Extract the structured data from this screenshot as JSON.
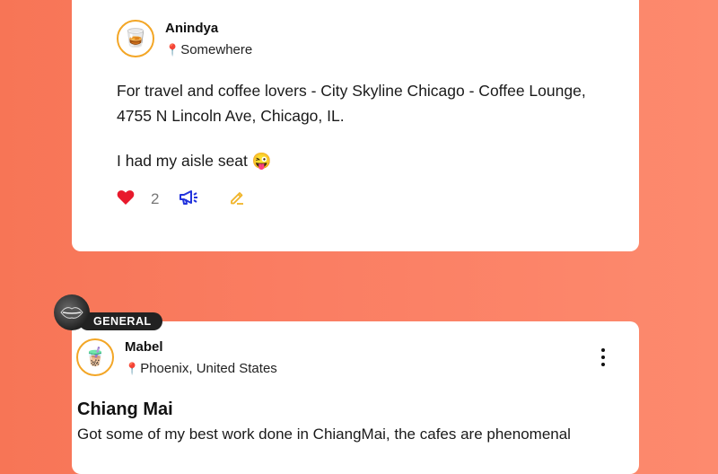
{
  "post1": {
    "avatar_icon": "iced-drink-icon",
    "username": "Anindya",
    "location": "Somewhere",
    "body_line1": "For travel and coffee lovers - City Skyline Chicago - Coffee Lounge,",
    "body_line2": "4755 N Lincoln Ave, Chicago, IL.",
    "body_line3": "I had my aisle seat 😜",
    "likes": "2",
    "icons": [
      "heart-icon",
      "megaphone-icon",
      "pencil-icon"
    ],
    "colors": {
      "heart": "#e8192c",
      "megaphone": "#2233dd",
      "pencil": "#f0b429"
    }
  },
  "post2": {
    "category": "GENERAL",
    "avatar_icon": "cold-brew-icon",
    "username": "Mabel",
    "location": "Phoenix, United States",
    "title": "Chiang Mai",
    "body": "Got some of my best work done in ChiangMai, the cafes are phenomenal"
  },
  "theme": {
    "background": "#fa7d62",
    "card": "#ffffff",
    "avatar_ring": "#f3a626"
  }
}
